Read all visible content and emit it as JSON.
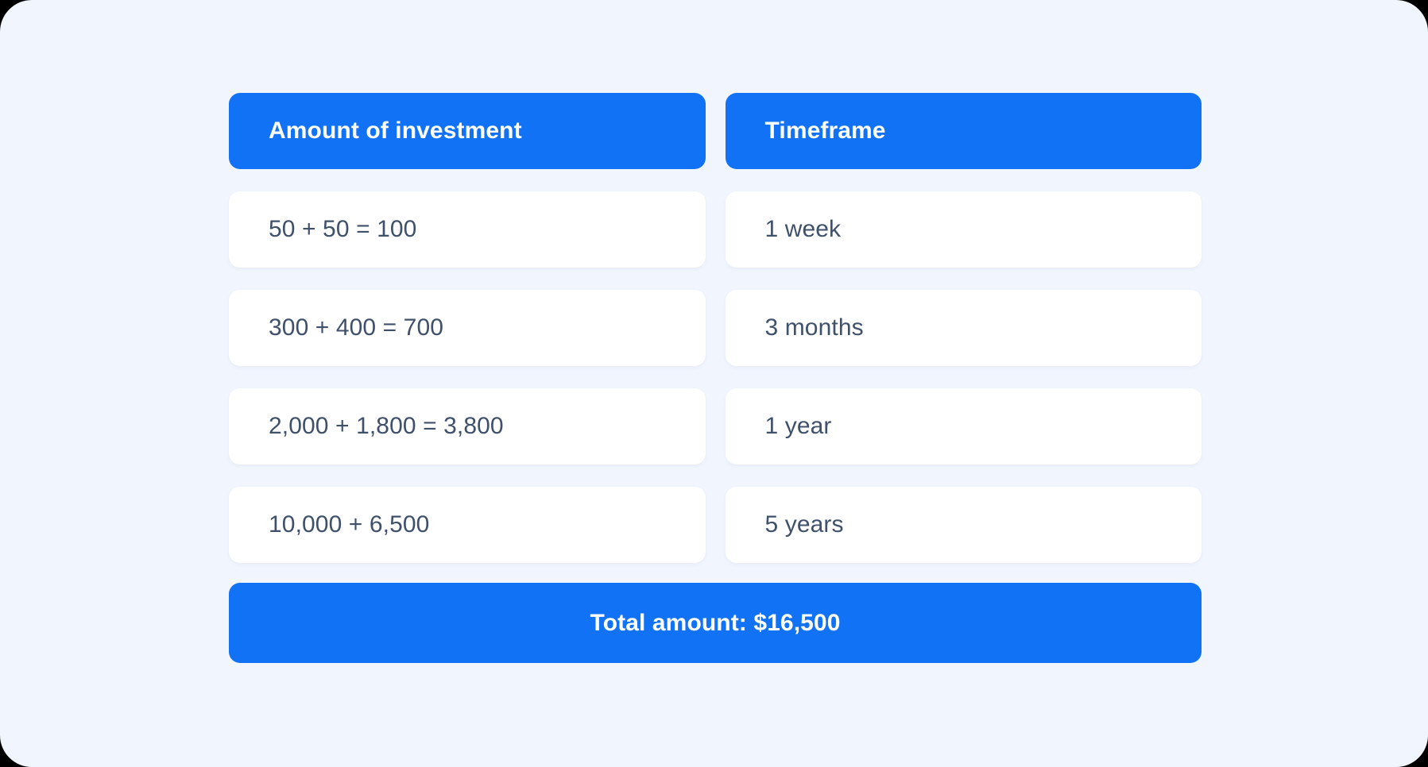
{
  "theme": {
    "page_background": "#f1f5fe",
    "accent_blue": "#1272f5",
    "card_background": "#ffffff",
    "body_text": "#3f506a",
    "header_text": "#ffffff"
  },
  "table": {
    "columns": [
      {
        "header": "Amount of investment",
        "cells": [
          "50 + 50 = 100",
          "300 + 400 = 700",
          "2,000 + 1,800 = 3,800",
          "10,000 + 6,500"
        ]
      },
      {
        "header": "Timeframe",
        "cells": [
          "1 week",
          "3 months",
          "1 year",
          "5 years"
        ]
      }
    ]
  },
  "total": {
    "label": "Total amount: $16,500"
  }
}
